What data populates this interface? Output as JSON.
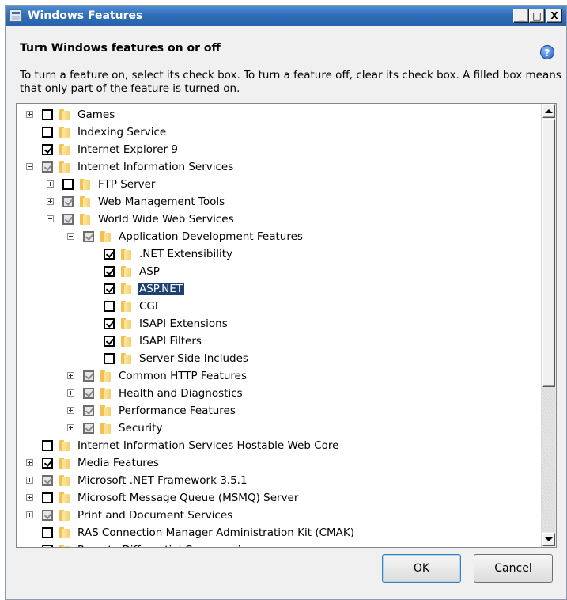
{
  "window": {
    "title": "Windows Features",
    "minimize_glyph": "_",
    "maximize_glyph": "□",
    "close_glyph": "X"
  },
  "header": {
    "title": "Turn Windows features on or off",
    "help_glyph": "?",
    "description": "To turn a feature on, select its check box. To turn a feature off, clear its check box. A filled box means that only part of the feature is turned on."
  },
  "tree": [
    {
      "label": "Games",
      "level": 0,
      "expander": "plus",
      "check": "none"
    },
    {
      "label": "Indexing Service",
      "level": 0,
      "expander": "",
      "check": "none"
    },
    {
      "label": "Internet Explorer 9",
      "level": 0,
      "expander": "",
      "check": "checked"
    },
    {
      "label": "Internet Information Services",
      "level": 0,
      "expander": "minus",
      "check": "partial"
    },
    {
      "label": "FTP Server",
      "level": 1,
      "expander": "plus",
      "check": "none"
    },
    {
      "label": "Web Management Tools",
      "level": 1,
      "expander": "plus",
      "check": "partial"
    },
    {
      "label": "World Wide Web Services",
      "level": 1,
      "expander": "minus",
      "check": "partial"
    },
    {
      "label": "Application Development Features",
      "level": 2,
      "expander": "minus",
      "check": "partial"
    },
    {
      "label": ".NET Extensibility",
      "level": 3,
      "expander": "",
      "check": "checked"
    },
    {
      "label": "ASP",
      "level": 3,
      "expander": "",
      "check": "checked"
    },
    {
      "label": "ASP.NET",
      "level": 3,
      "expander": "",
      "check": "checked",
      "selected": true
    },
    {
      "label": "CGI",
      "level": 3,
      "expander": "",
      "check": "none"
    },
    {
      "label": "ISAPI Extensions",
      "level": 3,
      "expander": "",
      "check": "checked"
    },
    {
      "label": "ISAPI Filters",
      "level": 3,
      "expander": "",
      "check": "checked"
    },
    {
      "label": "Server-Side Includes",
      "level": 3,
      "expander": "",
      "check": "none"
    },
    {
      "label": "Common HTTP Features",
      "level": 2,
      "expander": "plus",
      "check": "partial"
    },
    {
      "label": "Health and Diagnostics",
      "level": 2,
      "expander": "plus",
      "check": "partial"
    },
    {
      "label": "Performance Features",
      "level": 2,
      "expander": "plus",
      "check": "partial"
    },
    {
      "label": "Security",
      "level": 2,
      "expander": "plus",
      "check": "partial"
    },
    {
      "label": "Internet Information Services Hostable Web Core",
      "level": 0,
      "expander": "",
      "check": "none"
    },
    {
      "label": "Media Features",
      "level": 0,
      "expander": "plus",
      "check": "checked"
    },
    {
      "label": "Microsoft .NET Framework 3.5.1",
      "level": 0,
      "expander": "plus",
      "check": "partial"
    },
    {
      "label": "Microsoft Message Queue (MSMQ) Server",
      "level": 0,
      "expander": "plus",
      "check": "none"
    },
    {
      "label": "Print and Document Services",
      "level": 0,
      "expander": "plus",
      "check": "partial"
    },
    {
      "label": "RAS Connection Manager Administration Kit (CMAK)",
      "level": 0,
      "expander": "",
      "check": "none"
    },
    {
      "label": "Remote Differential Compression",
      "level": 0,
      "expander": "",
      "check": "checked"
    }
  ],
  "buttons": {
    "ok": "OK",
    "cancel": "Cancel"
  },
  "colors": {
    "titlebar": "#2f6cb8",
    "selection": "#1d3f73"
  }
}
